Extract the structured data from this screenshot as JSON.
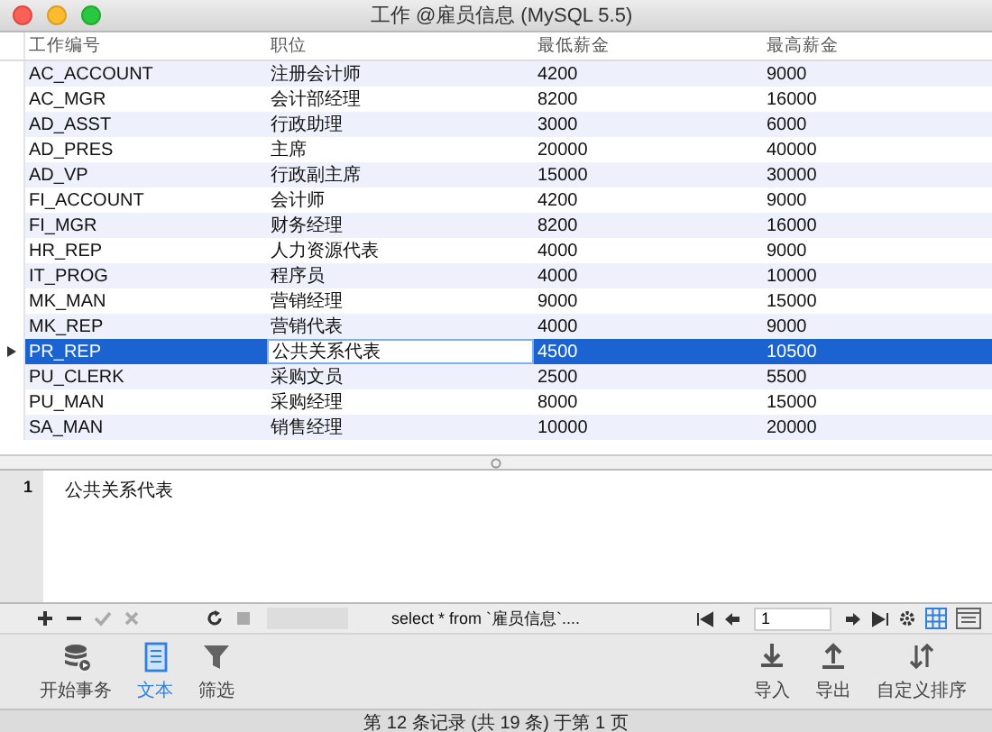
{
  "window": {
    "title": "工作 @雇员信息 (MySQL 5.5)"
  },
  "table": {
    "columns": [
      "工作编号",
      "职位",
      "最低薪金",
      "最高薪金"
    ],
    "rows": [
      {
        "selected": false,
        "cells": [
          {
            "text": "AC_ACCOUNT",
            "editing": false
          },
          {
            "text": "注册会计师",
            "editing": false
          },
          {
            "text": "4200",
            "editing": false
          },
          {
            "text": "9000",
            "editing": false
          }
        ]
      },
      {
        "selected": false,
        "cells": [
          {
            "text": "AC_MGR",
            "editing": false
          },
          {
            "text": "会计部经理",
            "editing": false
          },
          {
            "text": "8200",
            "editing": false
          },
          {
            "text": "16000",
            "editing": false
          }
        ]
      },
      {
        "selected": false,
        "cells": [
          {
            "text": "AD_ASST",
            "editing": false
          },
          {
            "text": "行政助理",
            "editing": false
          },
          {
            "text": "3000",
            "editing": false
          },
          {
            "text": "6000",
            "editing": false
          }
        ]
      },
      {
        "selected": false,
        "cells": [
          {
            "text": "AD_PRES",
            "editing": false
          },
          {
            "text": "主席",
            "editing": false
          },
          {
            "text": "20000",
            "editing": false
          },
          {
            "text": "40000",
            "editing": false
          }
        ]
      },
      {
        "selected": false,
        "cells": [
          {
            "text": "AD_VP",
            "editing": false
          },
          {
            "text": "行政副主席",
            "editing": false
          },
          {
            "text": "15000",
            "editing": false
          },
          {
            "text": "30000",
            "editing": false
          }
        ]
      },
      {
        "selected": false,
        "cells": [
          {
            "text": "FI_ACCOUNT",
            "editing": false
          },
          {
            "text": "会计师",
            "editing": false
          },
          {
            "text": "4200",
            "editing": false
          },
          {
            "text": "9000",
            "editing": false
          }
        ]
      },
      {
        "selected": false,
        "cells": [
          {
            "text": "FI_MGR",
            "editing": false
          },
          {
            "text": "财务经理",
            "editing": false
          },
          {
            "text": "8200",
            "editing": false
          },
          {
            "text": "16000",
            "editing": false
          }
        ]
      },
      {
        "selected": false,
        "cells": [
          {
            "text": "HR_REP",
            "editing": false
          },
          {
            "text": "人力资源代表",
            "editing": false
          },
          {
            "text": "4000",
            "editing": false
          },
          {
            "text": "9000",
            "editing": false
          }
        ]
      },
      {
        "selected": false,
        "cells": [
          {
            "text": "IT_PROG",
            "editing": false
          },
          {
            "text": "程序员",
            "editing": false
          },
          {
            "text": "4000",
            "editing": false
          },
          {
            "text": "10000",
            "editing": false
          }
        ]
      },
      {
        "selected": false,
        "cells": [
          {
            "text": "MK_MAN",
            "editing": false
          },
          {
            "text": "营销经理",
            "editing": false
          },
          {
            "text": "9000",
            "editing": false
          },
          {
            "text": "15000",
            "editing": false
          }
        ]
      },
      {
        "selected": false,
        "cells": [
          {
            "text": "MK_REP",
            "editing": false
          },
          {
            "text": "营销代表",
            "editing": false
          },
          {
            "text": "4000",
            "editing": false
          },
          {
            "text": "9000",
            "editing": false
          }
        ]
      },
      {
        "selected": true,
        "cells": [
          {
            "text": "PR_REP",
            "editing": false
          },
          {
            "text": "公共关系代表",
            "editing": true
          },
          {
            "text": "4500",
            "editing": false
          },
          {
            "text": "10500",
            "editing": false
          }
        ]
      },
      {
        "selected": false,
        "cells": [
          {
            "text": "PU_CLERK",
            "editing": false
          },
          {
            "text": "采购文员",
            "editing": false
          },
          {
            "text": "2500",
            "editing": false
          },
          {
            "text": "5500",
            "editing": false
          }
        ]
      },
      {
        "selected": false,
        "cells": [
          {
            "text": "PU_MAN",
            "editing": false
          },
          {
            "text": "采购经理",
            "editing": false
          },
          {
            "text": "8000",
            "editing": false
          },
          {
            "text": "15000",
            "editing": false
          }
        ]
      },
      {
        "selected": false,
        "cells": [
          {
            "text": "SA_MAN",
            "editing": false
          },
          {
            "text": "销售经理",
            "editing": false
          },
          {
            "text": "10000",
            "editing": false
          },
          {
            "text": "20000",
            "editing": false
          }
        ]
      }
    ]
  },
  "editor": {
    "line_numbers": [
      "1"
    ],
    "text": "公共关系代表"
  },
  "record_toolbar": {
    "actions": [
      {
        "kind": "add",
        "disabled": false
      },
      {
        "kind": "remove",
        "disabled": false
      },
      {
        "kind": "apply",
        "disabled": true
      },
      {
        "kind": "discard",
        "disabled": true
      },
      {
        "kind": "refresh",
        "disabled": false
      },
      {
        "kind": "stop",
        "disabled": true
      }
    ],
    "query": "select * from `雇员信息`....",
    "page": "1",
    "views": [
      {
        "kind": "grid",
        "selected": true
      },
      {
        "kind": "form",
        "selected": false
      }
    ]
  },
  "tools": [
    {
      "kind": "transaction",
      "label": "开始事务",
      "selected": false
    },
    {
      "kind": "text",
      "label": "文本",
      "selected": true
    },
    {
      "kind": "filter",
      "label": "筛选",
      "selected": false
    },
    {
      "kind": "spacer"
    },
    {
      "kind": "import",
      "label": "导入",
      "selected": false
    },
    {
      "kind": "export",
      "label": "导出",
      "selected": false
    },
    {
      "kind": "sort",
      "label": "自定义排序",
      "selected": false
    }
  ],
  "status_bar": "第 12 条记录 (共 19 条) 于第 1 页"
}
